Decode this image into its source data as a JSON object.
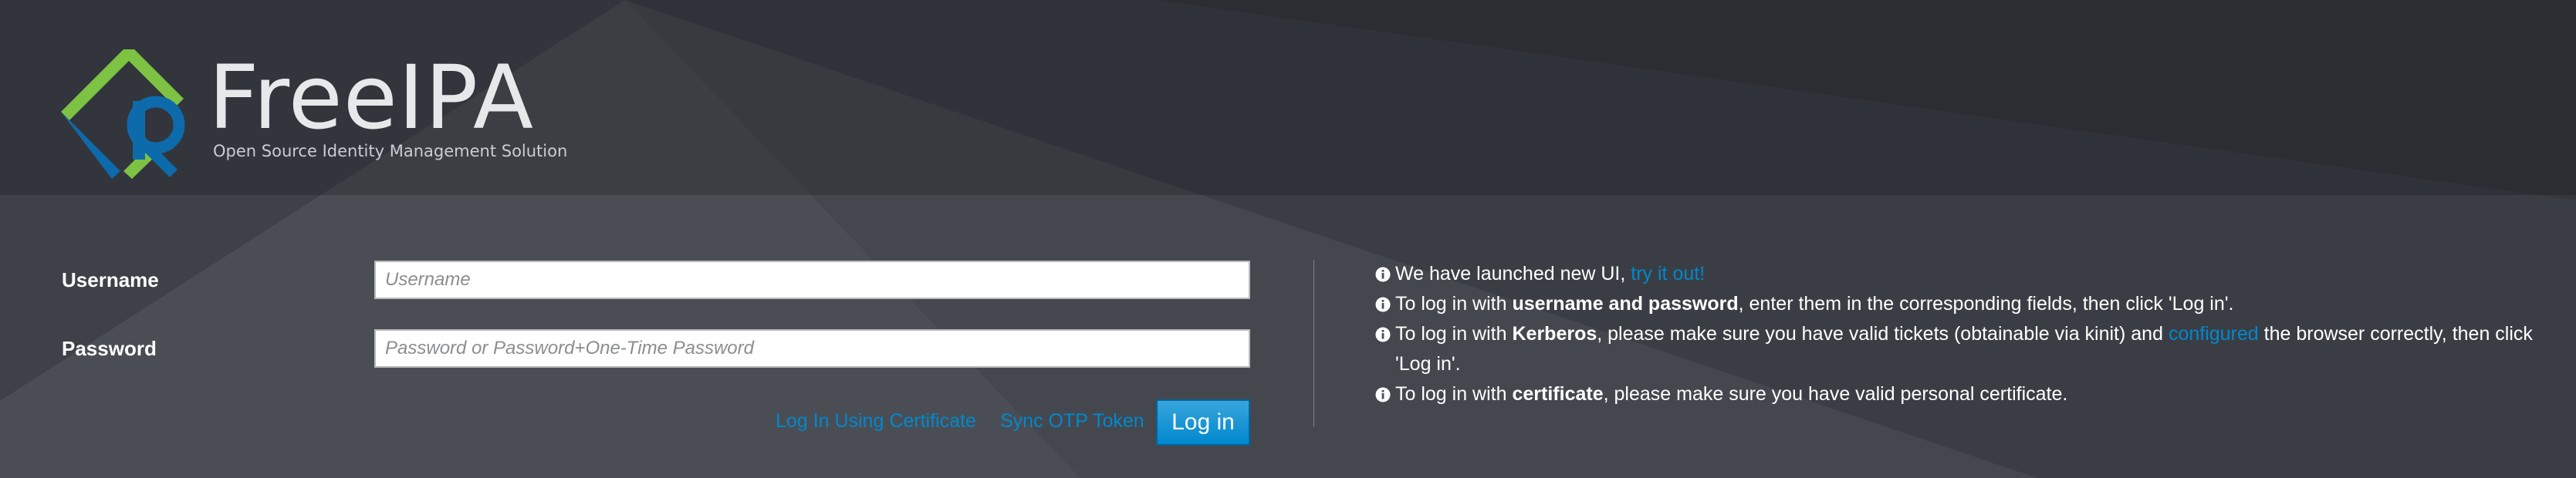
{
  "brand": {
    "name": "FreeIPA",
    "tagline": "Open Source Identity Management Solution",
    "colors": {
      "logo_green": "#7dc243",
      "logo_blue": "#0d6aab",
      "accent_blue": "#0088ce"
    }
  },
  "login_form": {
    "username_label": "Username",
    "username_placeholder": "Username",
    "username_value": "",
    "password_label": "Password",
    "password_placeholder": "Password or Password+One-Time Password",
    "password_value": "",
    "cert_link": "Log In Using Certificate",
    "otp_link": "Sync OTP Token",
    "login_button": "Log in"
  },
  "info": {
    "icon": "info-circle-icon",
    "new_ui": {
      "text_before": "We have launched new UI,",
      "link": "try it out!"
    },
    "password_login": {
      "text_before": "To log in with",
      "bold": "username and password",
      "text_after": ", enter them in the corresponding fields, then click 'Log in'."
    },
    "kerberos_login": {
      "text_before": "To log in with",
      "bold": "Kerberos",
      "text_middle": ", please make sure you have valid tickets (obtainable via kinit) and",
      "link": "configured",
      "text_after": "the browser correctly, then click 'Log in'."
    },
    "certificate_login": {
      "text_before": "To log in with",
      "bold": "certificate",
      "text_after": ", please make sure you have valid personal certificate."
    }
  }
}
